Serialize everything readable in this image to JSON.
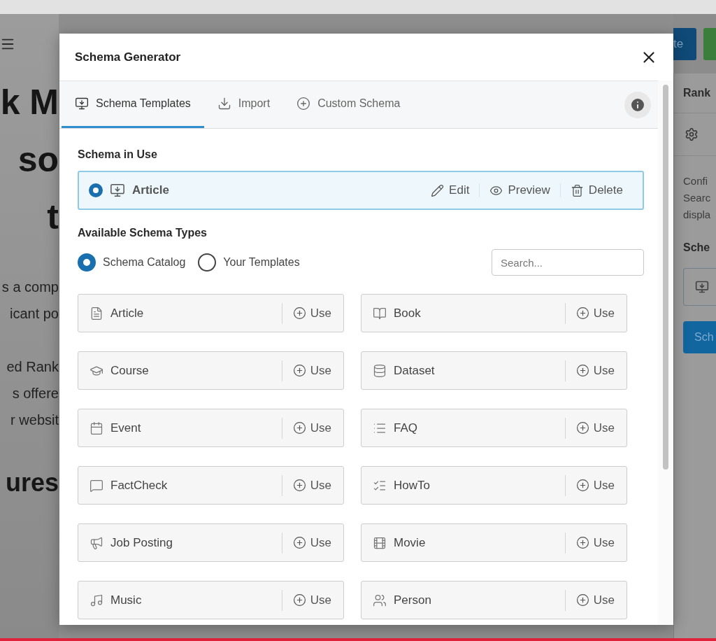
{
  "editor": {
    "publish_button": "te",
    "heading_lines": [
      "k M",
      "so",
      "t"
    ],
    "paragraph_lines": [
      "s a comp",
      "icant po",
      "ed Rank",
      "s offere",
      "r websit"
    ],
    "subheading": "ures"
  },
  "sidebar": {
    "title": "Rank",
    "description_lines": [
      "Confi",
      "Searc",
      "displa"
    ],
    "section_title": "Sche",
    "button": "Sch"
  },
  "dialog": {
    "title": "Schema Generator",
    "tabs": [
      {
        "label": "Schema Templates",
        "selected": true
      },
      {
        "label": "Import",
        "selected": false
      },
      {
        "label": "Custom Schema",
        "selected": false
      }
    ],
    "in_use_heading": "Schema in Use",
    "in_use": {
      "name": "Article",
      "selected": true,
      "actions": [
        "Edit",
        "Preview",
        "Delete"
      ]
    },
    "available_heading": "Available Schema Types",
    "sources": [
      {
        "label": "Schema Catalog",
        "selected": true
      },
      {
        "label": "Your Templates",
        "selected": false
      }
    ],
    "search": {
      "placeholder": "Search..."
    },
    "types": [
      {
        "name": "Article",
        "action": "Use"
      },
      {
        "name": "Book",
        "action": "Use"
      },
      {
        "name": "Course",
        "action": "Use"
      },
      {
        "name": "Dataset",
        "action": "Use"
      },
      {
        "name": "Event",
        "action": "Use"
      },
      {
        "name": "FAQ",
        "action": "Use"
      },
      {
        "name": "FactCheck",
        "action": "Use"
      },
      {
        "name": "HowTo",
        "action": "Use"
      },
      {
        "name": "Job Posting",
        "action": "Use"
      },
      {
        "name": "Movie",
        "action": "Use"
      },
      {
        "name": "Music",
        "action": "Use"
      },
      {
        "name": "Person",
        "action": "Use"
      }
    ]
  }
}
